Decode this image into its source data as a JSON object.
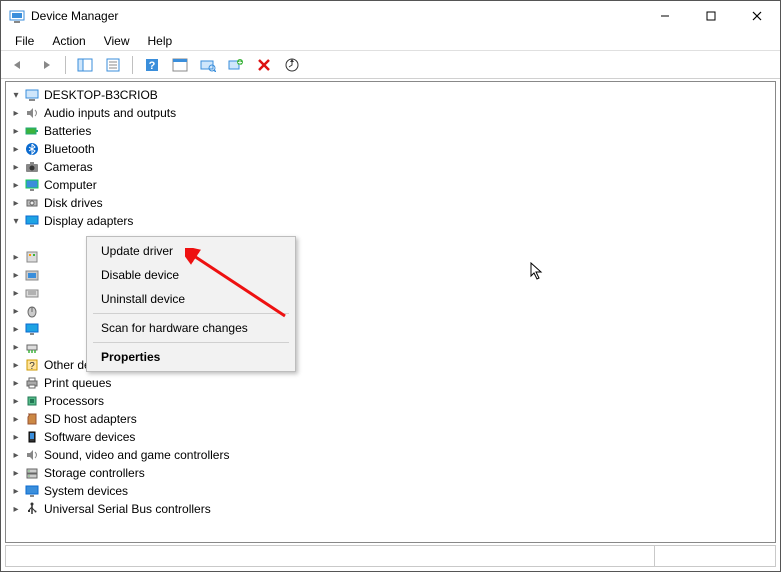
{
  "window": {
    "title": "Device Manager"
  },
  "menubar": {
    "items": [
      "File",
      "Action",
      "View",
      "Help"
    ]
  },
  "tree": {
    "root": "DESKTOP-B3CRIOB",
    "nodes": [
      {
        "label": "Audio inputs and outputs",
        "icon": "audio"
      },
      {
        "label": "Batteries",
        "icon": "battery"
      },
      {
        "label": "Bluetooth",
        "icon": "bluetooth"
      },
      {
        "label": "Cameras",
        "icon": "camera"
      },
      {
        "label": "Computer",
        "icon": "computer"
      },
      {
        "label": "Disk drives",
        "icon": "disk"
      },
      {
        "label": "Display adapters",
        "icon": "monitor",
        "expanded": true
      },
      {
        "label": "",
        "icon": "hid",
        "hidden": true
      },
      {
        "label": "",
        "icon": "imaging",
        "hidden": true
      },
      {
        "label": "",
        "icon": "keyboard",
        "hidden": true
      },
      {
        "label": "",
        "icon": "mouse",
        "hidden": true
      },
      {
        "label": "",
        "icon": "monitor2",
        "hidden": true
      },
      {
        "label": "",
        "icon": "network",
        "hidden": true
      },
      {
        "label": "Other devices",
        "icon": "other"
      },
      {
        "label": "Print queues",
        "icon": "printer"
      },
      {
        "label": "Processors",
        "icon": "cpu"
      },
      {
        "label": "SD host adapters",
        "icon": "sd"
      },
      {
        "label": "Software devices",
        "icon": "software"
      },
      {
        "label": "Sound, video and game controllers",
        "icon": "sound"
      },
      {
        "label": "Storage controllers",
        "icon": "storage"
      },
      {
        "label": "System devices",
        "icon": "system"
      },
      {
        "label": "Universal Serial Bus controllers",
        "icon": "usb"
      }
    ]
  },
  "context_menu": {
    "items": [
      "Update driver",
      "Disable device",
      "Uninstall device",
      "Scan for hardware changes",
      "Properties"
    ]
  }
}
